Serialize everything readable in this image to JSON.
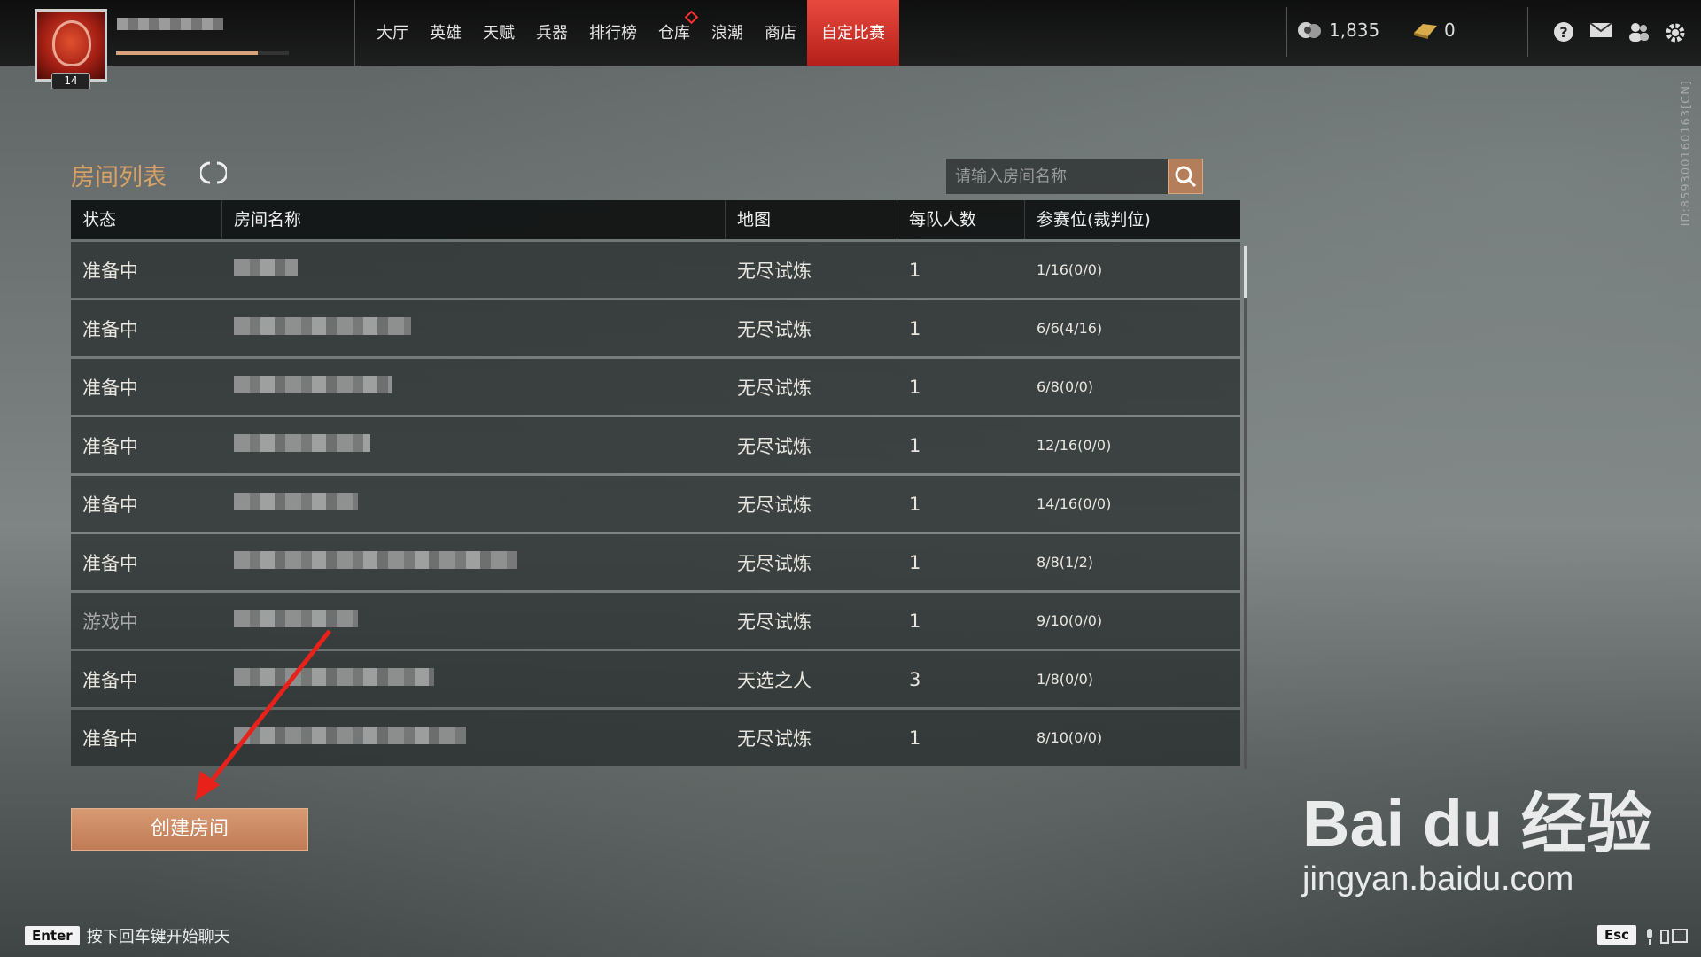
{
  "header": {
    "level": "14",
    "xp_progress": 0.82,
    "nav": [
      {
        "label": "大厅",
        "badge": false,
        "active": false
      },
      {
        "label": "英雄",
        "badge": false,
        "active": false
      },
      {
        "label": "天赋",
        "badge": false,
        "active": false
      },
      {
        "label": "兵器",
        "badge": false,
        "active": false
      },
      {
        "label": "排行榜",
        "badge": false,
        "active": false
      },
      {
        "label": "仓库",
        "badge": true,
        "active": false
      },
      {
        "label": "浪潮",
        "badge": false,
        "active": false
      },
      {
        "label": "商店",
        "badge": false,
        "active": false
      },
      {
        "label": "自定比赛",
        "badge": false,
        "active": true
      }
    ],
    "coins": "1,835",
    "gold": "0",
    "player_id": "ID:859300160163[CN]"
  },
  "room_list": {
    "title": "房间列表",
    "search_placeholder": "请输入房间名称",
    "columns": [
      "状态",
      "房间名称",
      "地图",
      "每队人数",
      "参赛位(裁判位)"
    ],
    "rows": [
      {
        "status": "准备中",
        "map": "无尽试炼",
        "team_size": "1",
        "slots": "1/16(0/0)"
      },
      {
        "status": "准备中",
        "map": "无尽试炼",
        "team_size": "1",
        "slots": "6/6(4/16)"
      },
      {
        "status": "准备中",
        "map": "无尽试炼",
        "team_size": "1",
        "slots": "6/8(0/0)"
      },
      {
        "status": "准备中",
        "map": "无尽试炼",
        "team_size": "1",
        "slots": "12/16(0/0)"
      },
      {
        "status": "准备中",
        "map": "无尽试炼",
        "team_size": "1",
        "slots": "14/16(0/0)"
      },
      {
        "status": "准备中",
        "map": "无尽试炼",
        "team_size": "1",
        "slots": "8/8(1/2)"
      },
      {
        "status": "游戏中",
        "map": "无尽试炼",
        "team_size": "1",
        "slots": "9/10(0/0)"
      },
      {
        "status": "准备中",
        "map": "天选之人",
        "team_size": "3",
        "slots": "1/8(0/0)"
      },
      {
        "status": "准备中",
        "map": "无尽试炼",
        "team_size": "1",
        "slots": "8/10(0/0)"
      }
    ],
    "create_button": "创建房间"
  },
  "footer": {
    "enter_key": "Enter",
    "chat_hint": "按下回车键开始聊天",
    "esc_key": "Esc"
  },
  "watermark": {
    "logo": "Bai du 经验",
    "url": "jingyan.baidu.com"
  },
  "colors": {
    "accent": "#d8a165",
    "nav_active": "#d33a30",
    "button": "#c98a63"
  }
}
